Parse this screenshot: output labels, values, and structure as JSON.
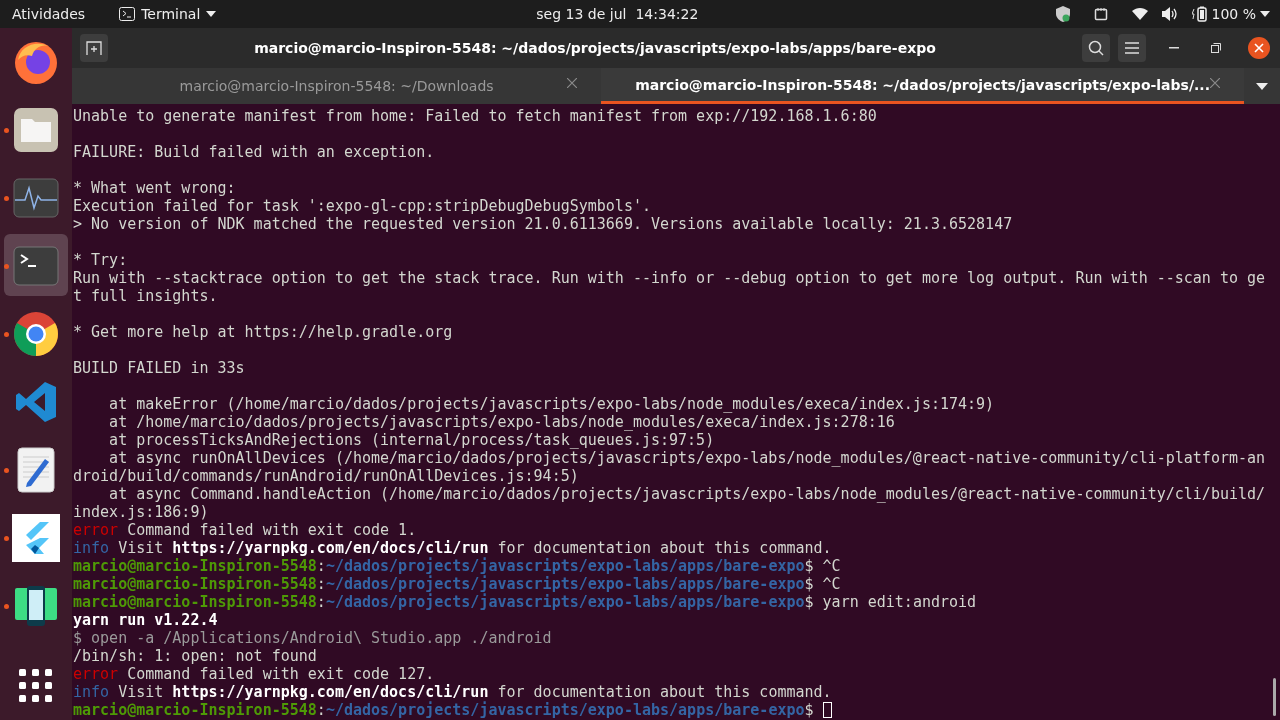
{
  "top_bar": {
    "activities": "Atividades",
    "app_menu": "Terminal",
    "date": "seg 13 de jul",
    "time": "14:34:22",
    "battery": "100 %"
  },
  "dock": [
    {
      "kind": "firefox",
      "running": false,
      "selected": false
    },
    {
      "kind": "files",
      "running": true,
      "selected": false
    },
    {
      "kind": "monitor",
      "running": true,
      "selected": false
    },
    {
      "kind": "terminal",
      "running": true,
      "selected": true
    },
    {
      "kind": "chrome",
      "running": true,
      "selected": false
    },
    {
      "kind": "vscode",
      "running": false,
      "selected": false
    },
    {
      "kind": "editor",
      "running": true,
      "selected": false
    },
    {
      "kind": "flutter",
      "running": true,
      "selected": false
    },
    {
      "kind": "android",
      "running": true,
      "selected": false
    },
    {
      "kind": "apps",
      "running": false,
      "selected": false
    }
  ],
  "window": {
    "title": "marcio@marcio-Inspiron-5548: ~/dados/projects/javascripts/expo-labs/apps/bare-expo",
    "tabs": [
      {
        "label": "marcio@marcio-Inspiron-5548: ~/Downloads",
        "selected": false
      },
      {
        "label": "marcio@marcio-Inspiron-5548: ~/dados/projects/javascripts/expo-labs/...",
        "selected": true
      }
    ]
  },
  "terminal": {
    "lines": [
      {
        "kind": "text",
        "segments": [
          {
            "kind": "plain",
            "text": "Unable to generate manifest from home: Failed to fetch manifest from exp://192.168.1.6:80"
          }
        ]
      },
      {
        "kind": "blank"
      },
      {
        "kind": "text",
        "segments": [
          {
            "kind": "plain",
            "text": "FAILURE: Build failed with an exception."
          }
        ]
      },
      {
        "kind": "blank"
      },
      {
        "kind": "text",
        "segments": [
          {
            "kind": "plain",
            "text": "* What went wrong:"
          }
        ]
      },
      {
        "kind": "text",
        "segments": [
          {
            "kind": "plain",
            "text": "Execution failed for task ':expo-gl-cpp:stripDebugDebugSymbols'."
          }
        ]
      },
      {
        "kind": "text",
        "segments": [
          {
            "kind": "plain",
            "text": "> No version of NDK matched the requested version 21.0.6113669. Versions available locally: 21.3.6528147"
          }
        ]
      },
      {
        "kind": "blank"
      },
      {
        "kind": "text",
        "segments": [
          {
            "kind": "plain",
            "text": "* Try:"
          }
        ]
      },
      {
        "kind": "text",
        "segments": [
          {
            "kind": "plain",
            "text": "Run with --stacktrace option to get the stack trace. Run with --info or --debug option to get more log output. Run with --scan to ge"
          }
        ]
      },
      {
        "kind": "text",
        "segments": [
          {
            "kind": "plain",
            "text": "t full insights."
          }
        ]
      },
      {
        "kind": "blank"
      },
      {
        "kind": "text",
        "segments": [
          {
            "kind": "plain",
            "text": "* Get more help at https://help.gradle.org"
          }
        ]
      },
      {
        "kind": "blank"
      },
      {
        "kind": "text",
        "segments": [
          {
            "kind": "plain",
            "text": "BUILD FAILED in 33s"
          }
        ]
      },
      {
        "kind": "blank"
      },
      {
        "kind": "text",
        "segments": [
          {
            "kind": "plain",
            "text": "    at makeError (/home/marcio/dados/projects/javascripts/expo-labs/node_modules/execa/index.js:174:9)"
          }
        ]
      },
      {
        "kind": "text",
        "segments": [
          {
            "kind": "plain",
            "text": "    at /home/marcio/dados/projects/javascripts/expo-labs/node_modules/execa/index.js:278:16"
          }
        ]
      },
      {
        "kind": "text",
        "segments": [
          {
            "kind": "plain",
            "text": "    at processTicksAndRejections (internal/process/task_queues.js:97:5)"
          }
        ]
      },
      {
        "kind": "text",
        "segments": [
          {
            "kind": "plain",
            "text": "    at async runOnAllDevices (/home/marcio/dados/projects/javascripts/expo-labs/node_modules/@react-native-community/cli-platform-an"
          }
        ]
      },
      {
        "kind": "text",
        "segments": [
          {
            "kind": "plain",
            "text": "droid/build/commands/runAndroid/runOnAllDevices.js:94:5)"
          }
        ]
      },
      {
        "kind": "text",
        "segments": [
          {
            "kind": "plain",
            "text": "    at async Command.handleAction (/home/marcio/dados/projects/javascripts/expo-labs/node_modules/@react-native-community/cli/build/"
          }
        ]
      },
      {
        "kind": "text",
        "segments": [
          {
            "kind": "plain",
            "text": "index.js:186:9)"
          }
        ]
      },
      {
        "kind": "text",
        "segments": [
          {
            "kind": "error",
            "text": "error"
          },
          {
            "kind": "plain",
            "text": " Command failed with exit code 1."
          }
        ]
      },
      {
        "kind": "text",
        "segments": [
          {
            "kind": "info",
            "text": "info"
          },
          {
            "kind": "plain",
            "text": " Visit "
          },
          {
            "kind": "bold",
            "text": "https://yarnpkg.com/en/docs/cli/run"
          },
          {
            "kind": "plain",
            "text": " for documentation about this command."
          }
        ]
      },
      {
        "kind": "text",
        "segments": [
          {
            "kind": "user",
            "text": "marcio@marcio-Inspiron-5548"
          },
          {
            "kind": "plain",
            "text": ":"
          },
          {
            "kind": "path",
            "text": "~/dados/projects/javascripts/expo-labs/apps/bare-expo"
          },
          {
            "kind": "plain",
            "text": "$ ^C"
          }
        ]
      },
      {
        "kind": "text",
        "segments": [
          {
            "kind": "user",
            "text": "marcio@marcio-Inspiron-5548"
          },
          {
            "kind": "plain",
            "text": ":"
          },
          {
            "kind": "path",
            "text": "~/dados/projects/javascripts/expo-labs/apps/bare-expo"
          },
          {
            "kind": "plain",
            "text": "$ ^C"
          }
        ]
      },
      {
        "kind": "text",
        "segments": [
          {
            "kind": "user",
            "text": "marcio@marcio-Inspiron-5548"
          },
          {
            "kind": "plain",
            "text": ":"
          },
          {
            "kind": "path",
            "text": "~/dados/projects/javascripts/expo-labs/apps/bare-expo"
          },
          {
            "kind": "plain",
            "text": "$ yarn edit:android"
          }
        ]
      },
      {
        "kind": "text",
        "segments": [
          {
            "kind": "bold",
            "text": "yarn run v1.22.4"
          }
        ]
      },
      {
        "kind": "text",
        "segments": [
          {
            "kind": "dim",
            "text": "$ open -a /Applications/Android\\ Studio.app ./android"
          }
        ]
      },
      {
        "kind": "text",
        "segments": [
          {
            "kind": "plain",
            "text": "/bin/sh: 1: open: not found"
          }
        ]
      },
      {
        "kind": "text",
        "segments": [
          {
            "kind": "error",
            "text": "error"
          },
          {
            "kind": "plain",
            "text": " Command failed with exit code 127."
          }
        ]
      },
      {
        "kind": "text",
        "segments": [
          {
            "kind": "info",
            "text": "info"
          },
          {
            "kind": "plain",
            "text": " Visit "
          },
          {
            "kind": "bold",
            "text": "https://yarnpkg.com/en/docs/cli/run"
          },
          {
            "kind": "plain",
            "text": " for documentation about this command."
          }
        ]
      },
      {
        "kind": "text",
        "segments": [
          {
            "kind": "user",
            "text": "marcio@marcio-Inspiron-5548"
          },
          {
            "kind": "plain",
            "text": ":"
          },
          {
            "kind": "path",
            "text": "~/dados/projects/javascripts/expo-labs/apps/bare-expo"
          },
          {
            "kind": "plain",
            "text": "$ "
          }
        ],
        "cursor": true
      }
    ]
  }
}
